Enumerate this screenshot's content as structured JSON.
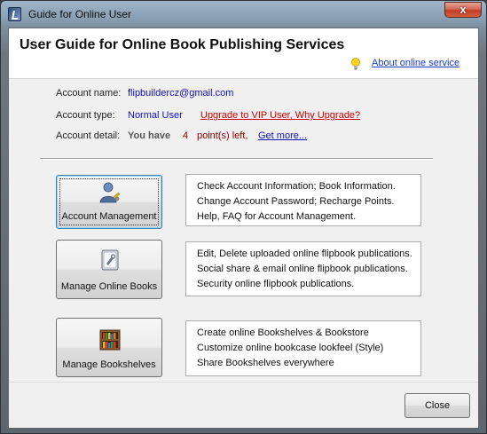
{
  "window": {
    "title": "Guide for Online User",
    "close_glyph": "x"
  },
  "header": {
    "title": "User Guide for Online Book Publishing Services",
    "about_link": "About online service"
  },
  "account": {
    "name_label": "Account name:",
    "name_value": "flipbuildercz@gmail.com",
    "type_label": "Account type:",
    "type_value": "Normal User",
    "upgrade_link": "Upgrade to VIP User, Why Upgrade?",
    "detail_label": "Account detail:",
    "have_text": "You have",
    "points": "4",
    "points_suffix": "point(s) left,",
    "get_more_link": "Get more..."
  },
  "actions": [
    {
      "label": "Account Management",
      "icon": "user-management-icon",
      "lines": [
        "Check Account Information;  Book Information.",
        "Change Account Password;  Recharge Points.",
        "Help, FAQ for Account Management."
      ]
    },
    {
      "label": "Manage Online Books",
      "icon": "online-book-icon",
      "lines": [
        "Edit, Delete uploaded online flipbook publications.",
        "Social share & email online flipbook publications.",
        "Security online flipbook publications."
      ]
    },
    {
      "label": "Manage Bookshelves",
      "icon": "bookshelf-icon",
      "lines": [
        "Create online Bookshelves & Bookstore",
        "Customize online bookcase lookfeel (Style)",
        "Share Bookshelves everywhere"
      ]
    }
  ],
  "footer": {
    "close_label": "Close"
  },
  "colors": {
    "link_blue": "#1111bb",
    "link_red": "#cc0000",
    "points_red": "#8a0000",
    "focus_blue": "#3c7fb1"
  }
}
